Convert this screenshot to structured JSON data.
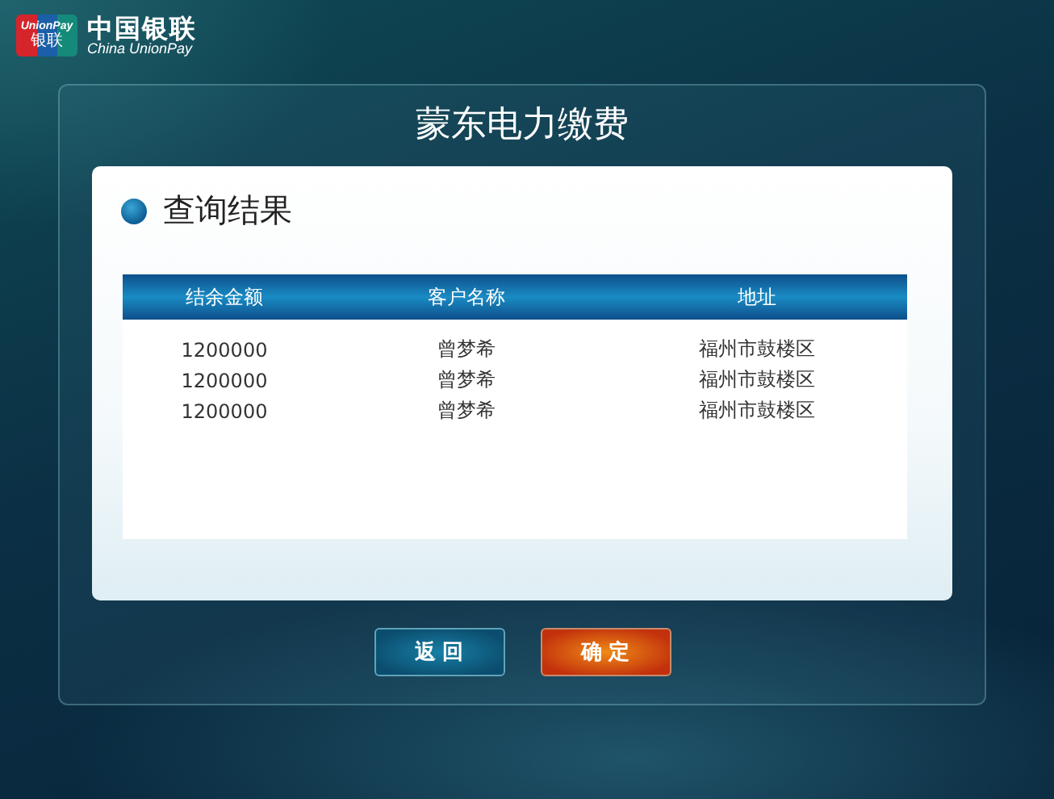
{
  "logo": {
    "card_text": "UnionPay",
    "card_text_cn": "银联",
    "name_cn": "中国银联",
    "name_en": "China UnionPay"
  },
  "title": "蒙东电力缴费",
  "section": {
    "heading": "查询结果"
  },
  "table": {
    "columns": [
      "结余金额",
      "客户名称",
      "地址"
    ],
    "rows": [
      [
        "1200000",
        "曾梦希",
        "福州市鼓楼区"
      ],
      [
        "1200000",
        "曾梦希",
        "福州市鼓楼区"
      ],
      [
        "1200000",
        "曾梦希",
        "福州市鼓楼区"
      ]
    ]
  },
  "buttons": [
    {
      "label": "返回",
      "kind": "secondary"
    },
    {
      "label": "确定",
      "kind": "primary"
    }
  ]
}
